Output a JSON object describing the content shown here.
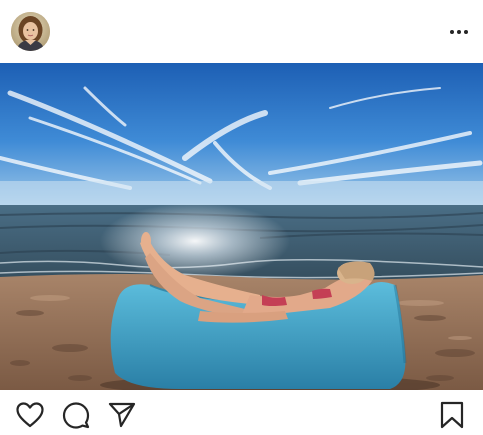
{
  "post": {
    "author_avatar": "profile-photo",
    "image_description_icon": "beach-photo",
    "more_icon": "more-horizontal-icon"
  },
  "actions": {
    "like_icon": "heart-icon",
    "comment_icon": "comment-bubble-icon",
    "share_icon": "send-paper-plane-icon",
    "save_icon": "bookmark-icon"
  },
  "colors": {
    "background": "#ffffff",
    "icon": "#262626",
    "sky": "#2e73c4",
    "sea": "#3c5a6e",
    "sand": "#9a7356",
    "lounger": "#3b9fc0"
  }
}
